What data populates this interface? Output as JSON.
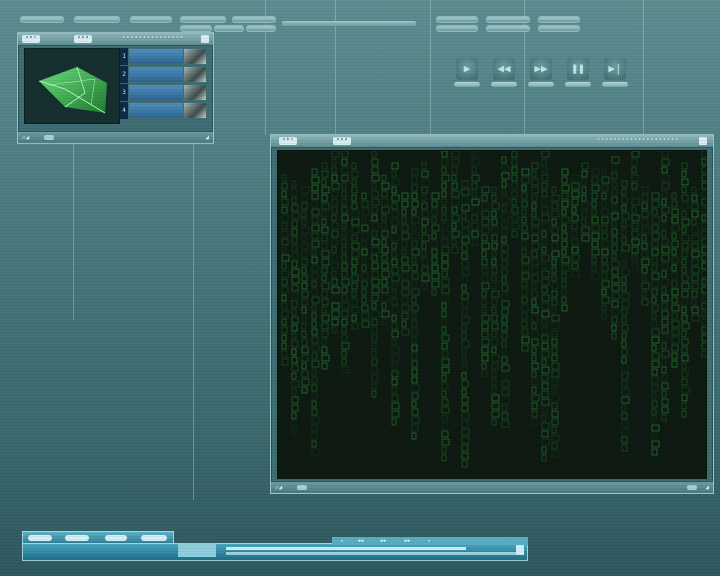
{
  "thumbnail_panel": {
    "tab1": "ᵃᵇᶜ",
    "tab2": "ᵃᵇᵈ",
    "title": "ᶦᶦᶦᶦᶦᶦᶦᶦᶦᶦᶦᶦᶦᶦᶦ",
    "strip_numbers": [
      "1",
      "2",
      "3",
      "4"
    ]
  },
  "viewer_panel": {
    "tab1": "ᵃᵇᶜ",
    "tab2": "ᵃᵇᵈ",
    "title": "ᶦᶦᶦᶦᶦᶦᶦᶦᶦᶦᶦᶦᶦᶦᶦᶦᶦᶦᶦᶦ"
  },
  "playback_controls": [
    {
      "name": "play",
      "icon": "play-icon",
      "glyph": "▶"
    },
    {
      "name": "rewind",
      "icon": "rewind-icon",
      "glyph": "◀◀"
    },
    {
      "name": "fast-forward",
      "icon": "fast-forward-icon",
      "glyph": "▶▶"
    },
    {
      "name": "pause",
      "icon": "pause-icon",
      "glyph": "❚❚"
    },
    {
      "name": "step",
      "icon": "step-icon",
      "glyph": "▶|"
    }
  ],
  "colors": {
    "accent": "#9cc5c9",
    "matrix_green": "#39d04a",
    "dock_blue": "#2c7f97"
  }
}
